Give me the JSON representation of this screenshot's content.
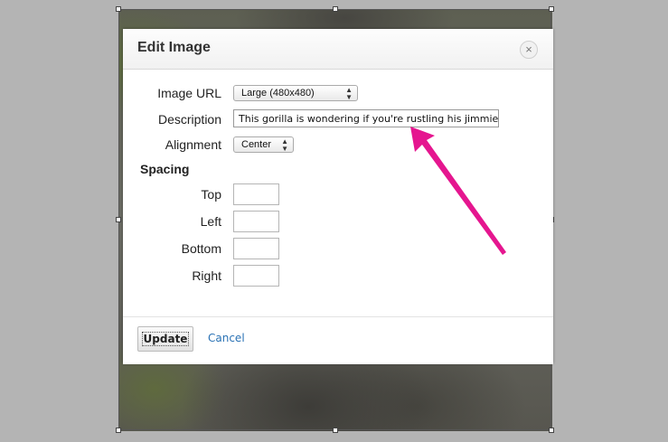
{
  "dialog": {
    "title": "Edit Image",
    "close_glyph": "×"
  },
  "fields": {
    "image_url_label": "Image URL",
    "image_url_value": "Large (480x480)",
    "description_label": "Description",
    "description_value": "This gorilla is wondering if you're rustling his jimmies",
    "alignment_label": "Alignment",
    "alignment_value": "Center"
  },
  "spacing": {
    "title": "Spacing",
    "top_label": "Top",
    "left_label": "Left",
    "bottom_label": "Bottom",
    "right_label": "Right",
    "top_value": "",
    "left_value": "",
    "bottom_value": "",
    "right_value": ""
  },
  "footer": {
    "update_label": "Update",
    "cancel_label": "Cancel"
  },
  "colors": {
    "annotation_arrow": "#e5168f",
    "link": "#2a72b5"
  },
  "icons": {
    "close": "close-icon",
    "select_arrows": "updown-chevron-icon"
  }
}
